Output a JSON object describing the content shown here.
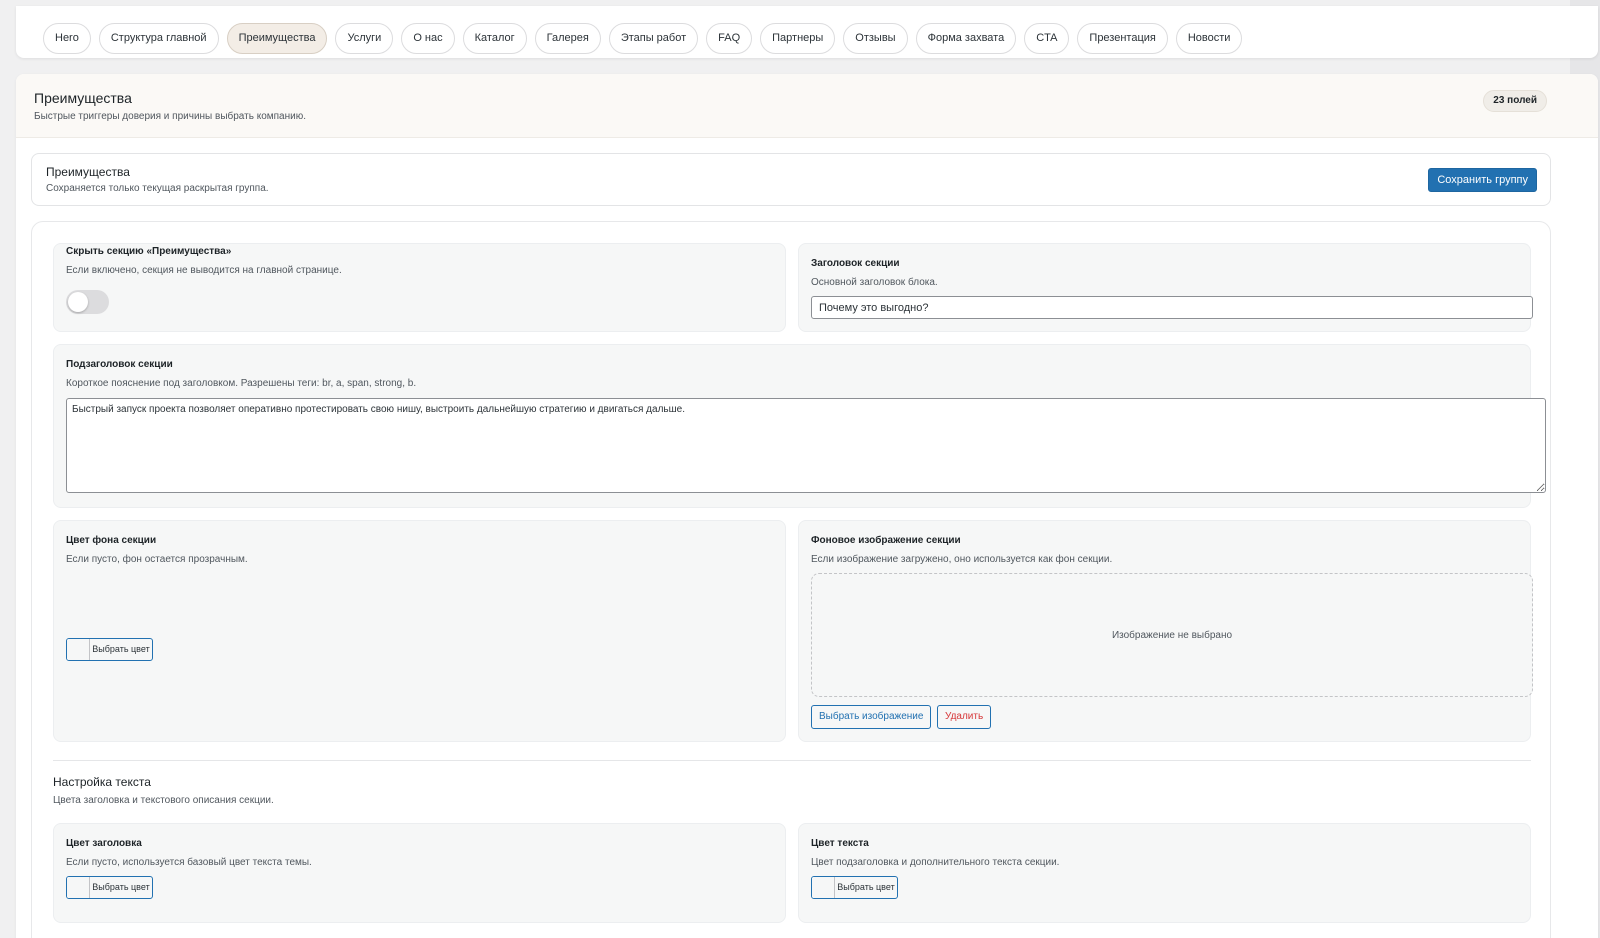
{
  "tabs": [
    {
      "label": "Hero",
      "active": false
    },
    {
      "label": "Структура главной",
      "active": false
    },
    {
      "label": "Преимущества",
      "active": true
    },
    {
      "label": "Услуги",
      "active": false
    },
    {
      "label": "О нас",
      "active": false
    },
    {
      "label": "Каталог",
      "active": false
    },
    {
      "label": "Галерея",
      "active": false
    },
    {
      "label": "Этапы работ",
      "active": false
    },
    {
      "label": "FAQ",
      "active": false
    },
    {
      "label": "Партнеры",
      "active": false
    },
    {
      "label": "Отзывы",
      "active": false
    },
    {
      "label": "Форма захвата",
      "active": false
    },
    {
      "label": "CTA",
      "active": false
    },
    {
      "label": "Презентация",
      "active": false
    },
    {
      "label": "Новости",
      "active": false
    }
  ],
  "panel": {
    "title": "Преимущества",
    "subtitle": "Быстрые триггеры доверия и причины выбрать компанию.",
    "fields_count": "23 полей"
  },
  "group": {
    "title": "Преимущества",
    "subtitle": "Сохраняется только текущая раскрытая группа.",
    "save_label": "Сохранить группу"
  },
  "fields": {
    "hide_section": {
      "label": "Скрыть секцию «Преимущества»",
      "desc": "Если включено, секция не выводится на главной странице.",
      "enabled": false
    },
    "section_title": {
      "label": "Заголовок секции",
      "desc": "Основной заголовок блока.",
      "value": "Почему это выгодно?"
    },
    "section_subtitle": {
      "label": "Подзаголовок секции",
      "desc": "Короткое пояснение под заголовком. Разрешены теги: br, a, span, strong, b.",
      "value": "Быстрый запуск проекта позволяет оперативно протестировать свою нишу, выстроить дальнейшую стратегию и двигаться дальше."
    },
    "bg_color": {
      "label": "Цвет фона секции",
      "desc": "Если пусто, фон остается прозрачным.",
      "button": "Выбрать цвет"
    },
    "bg_image": {
      "label": "Фоновое изображение секции",
      "desc": "Если изображение загружено, оно используется как фон секции.",
      "empty": "Изображение не выбрано",
      "choose_label": "Выбрать изображение",
      "delete_label": "Удалить"
    }
  },
  "text_settings": {
    "title": "Настройка текста",
    "subtitle": "Цвета заголовка и текстового описания секции.",
    "heading_color": {
      "label": "Цвет заголовка",
      "desc": "Если пусто, используется базовый цвет текста темы.",
      "button": "Выбрать цвет"
    },
    "text_color": {
      "label": "Цвет текста",
      "desc": "Цвет подзаголовка и дополнительного текста секции.",
      "button": "Выбрать цвет"
    }
  },
  "colors": {
    "primary": "#2271b1",
    "danger": "#d63638",
    "active_tab_bg": "#f3ede6"
  }
}
